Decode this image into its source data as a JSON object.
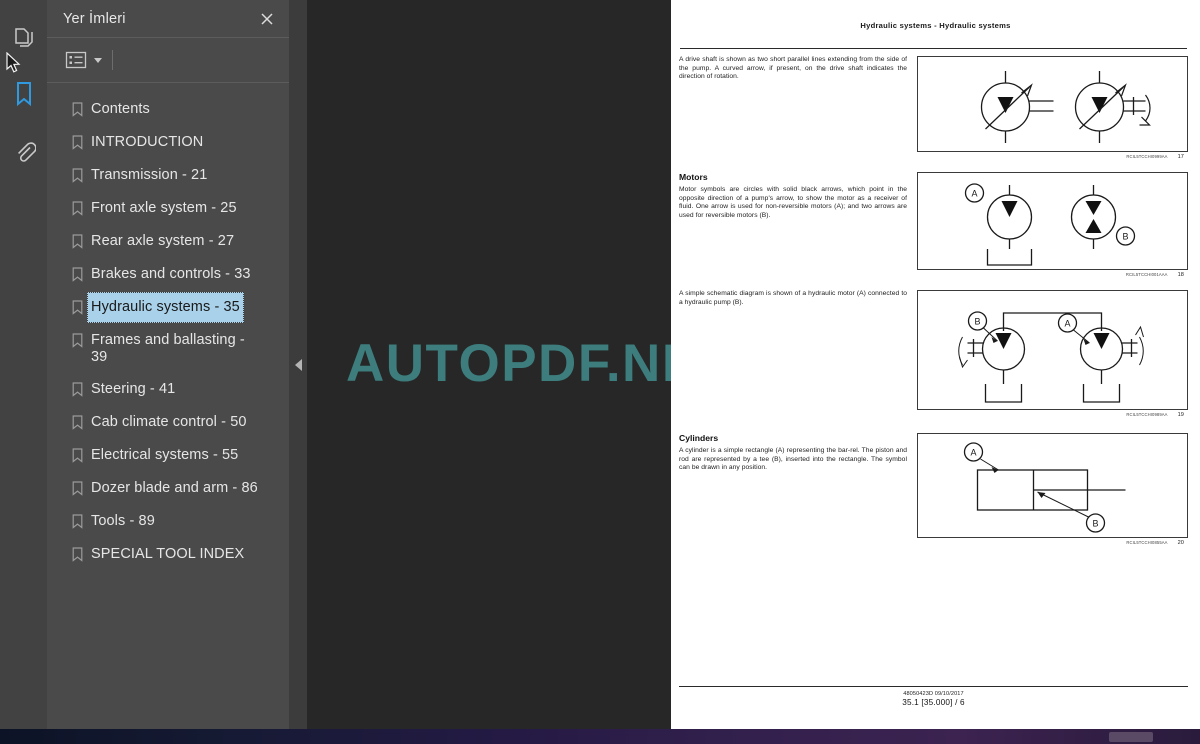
{
  "rail": {
    "items": [
      {
        "name": "page-thumbnails-icon",
        "label": "Page Thumbnails",
        "active": false
      },
      {
        "name": "bookmarks-icon",
        "label": "Bookmarks",
        "active": true
      },
      {
        "name": "attachments-icon",
        "label": "Attachments",
        "active": false
      }
    ],
    "active_color": "#2f9ae0"
  },
  "panel": {
    "title": "Yer İmleri",
    "close_label": "✕",
    "toolbar": {
      "options_icon": "list-options-icon",
      "dropdown_icon": "chevron-down-icon"
    },
    "bookmarks": [
      {
        "label": "Contents",
        "selected": false
      },
      {
        "label": "INTRODUCTION",
        "selected": false
      },
      {
        "label": "Transmission - 21",
        "selected": false
      },
      {
        "label": "Front axle system - 25",
        "selected": false
      },
      {
        "label": "Rear axle system - 27",
        "selected": false
      },
      {
        "label": "Brakes and controls - 33",
        "selected": false
      },
      {
        "label": "Hydraulic systems - 35",
        "selected": true
      },
      {
        "label": "Frames and ballasting - 39",
        "selected": false
      },
      {
        "label": "Steering - 41",
        "selected": false
      },
      {
        "label": "Cab climate control - 50",
        "selected": false
      },
      {
        "label": "Electrical systems - 55",
        "selected": false
      },
      {
        "label": "Dozer blade and arm - 86",
        "selected": false
      },
      {
        "label": "Tools - 89",
        "selected": false
      },
      {
        "label": "SPECIAL TOOL INDEX",
        "selected": false
      }
    ],
    "collapse_icon": "collapse-left-icon"
  },
  "viewer": {
    "watermark": "AUTOPDF.NET",
    "watermark_color": "#3d7d7d"
  },
  "document": {
    "header": "Hydraulic systems - Hydraulic systems",
    "blocks": [
      {
        "title": "",
        "text": "A drive shaft is shown as two short parallel lines extending from the side of the pump.  A curved arrow, if present, on the drive shaft indicates the direction of rotation.",
        "figure_ref": "RCIL5TCCHI0999AA",
        "figure_num": "17"
      },
      {
        "title": "Motors",
        "text": "Motor symbols are circles with solid black arrows, which point in the opposite direction of a pump's arrow, to show the motor as a receiver of fluid.  One arrow is used for non-reversible motors (A); and two arrows are used for reversible motors (B).",
        "figure_ref": "RCIL5TCCHI001AAA",
        "figure_num": "18"
      },
      {
        "title": "",
        "text": "A simple schematic diagram is shown of a hydraulic motor (A) connected to a hydraulic pump (B).",
        "figure_ref": "RCIL5TCCHI0989AA",
        "figure_num": "19"
      },
      {
        "title": "Cylinders",
        "text": "A cylinder is a simple rectangle (A) representing the bar-rel.  The piston and rod are represented by a tee (B), inserted into the rectangle.  The symbol can be drawn in any position.",
        "figure_ref": "RCIL5TCCHI0855AA",
        "figure_num": "20"
      }
    ],
    "figure_callouts": {
      "a": "A",
      "b": "B"
    },
    "footer": {
      "line1": "48050423D 09/10/2017",
      "line2": "35.1 [35.000] / 6"
    }
  }
}
